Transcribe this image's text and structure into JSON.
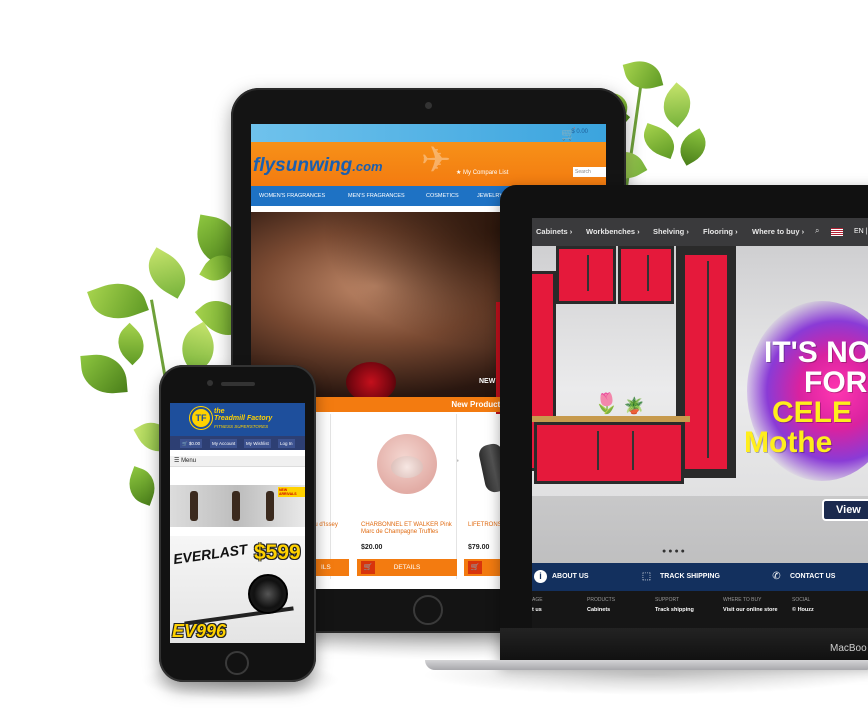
{
  "tablet": {
    "cart_text": "$ 0.00",
    "logo_main": "flysunwing",
    "logo_tld": ".com",
    "compare_link": "My Compare List",
    "search_placeholder": "Search",
    "nav": [
      "WOMEN'S FRAGRANCES",
      "MEN'S FRAGRANCES",
      "COSMETICS",
      "JEWELRY"
    ],
    "hero_badge": "NEW",
    "section_title": "New Products",
    "products": [
      {
        "name": "au d'Issey",
        "price": "",
        "button": "ILS"
      },
      {
        "name": "CHARBONNEL ET WALKER Pink Marc de Champagne Truffles",
        "price": "$20.00",
        "button": "DETAILS"
      },
      {
        "name": "LIFETRONS Bluetooth S Wireless E",
        "price": "$79.00",
        "button": ""
      }
    ]
  },
  "laptop": {
    "nav": [
      "Cabinets ›",
      "Workbenches ›",
      "Shelving ›",
      "Flooring ›",
      "Where to buy ›"
    ],
    "lang": "EN |",
    "hero_lines": [
      "IT'S NO",
      "FOR",
      "CELE",
      "Mothe"
    ],
    "view_button": "View",
    "bar": [
      "ABOUT US",
      "TRACK SHIPPING",
      "CONTACT US"
    ],
    "footer_headers": [
      "AGE",
      "PRODUCTS",
      "SUPPORT",
      "WHERE TO BUY",
      "SOCIAL"
    ],
    "footer_values": [
      "t us",
      "Cabinets",
      "Track shipping",
      "Visit our online store",
      "© Houzz"
    ],
    "brand": "MacBoo"
  },
  "phone": {
    "logo_line1": "the",
    "logo_line2": "Treadmill Factory",
    "logo_sub": "FITNESS SUPERSTORES",
    "logo_mark": "TF",
    "cart": "$0.00",
    "account": "My Account",
    "wishlist": "My Wishlist",
    "login": "Log In",
    "menu": "Menu",
    "promo_tag": "NEW ARRIVALS",
    "brand": "EVERLAST",
    "price": "$599",
    "model": "EV996"
  }
}
